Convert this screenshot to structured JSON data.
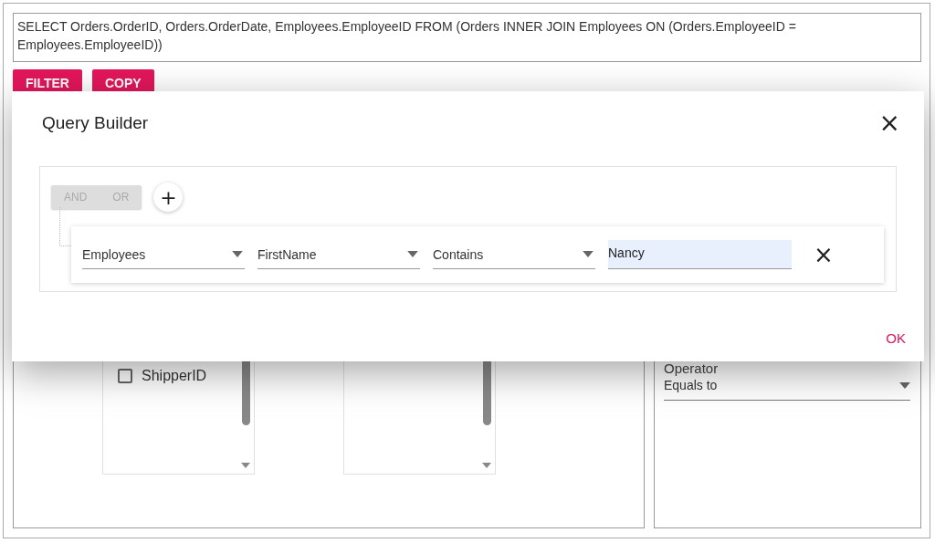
{
  "query_text": "SELECT Orders.OrderID, Orders.OrderDate, Employees.EmployeeID FROM (Orders INNER JOIN Employees ON (Orders.EmployeeID = Employees.EmployeeID))",
  "buttons": [
    "FILTER",
    "COPY"
  ],
  "column_list": [
    {
      "label": "ShipperID",
      "checked": false
    }
  ],
  "operator": {
    "label": "Operator",
    "value": "Equals to"
  },
  "dialog": {
    "title": "Query Builder",
    "close": "×",
    "group": {
      "conditions": [
        "AND",
        "OR"
      ],
      "add": "+",
      "rule": {
        "fields": [
          {
            "kind": "dropdown",
            "value": "Employees"
          },
          {
            "kind": "dropdown",
            "value": "FirstName"
          },
          {
            "kind": "dropdown",
            "value": "Contains"
          },
          {
            "kind": "text",
            "value": "Nancy"
          }
        ],
        "remove": "×"
      }
    },
    "ok": "OK"
  }
}
